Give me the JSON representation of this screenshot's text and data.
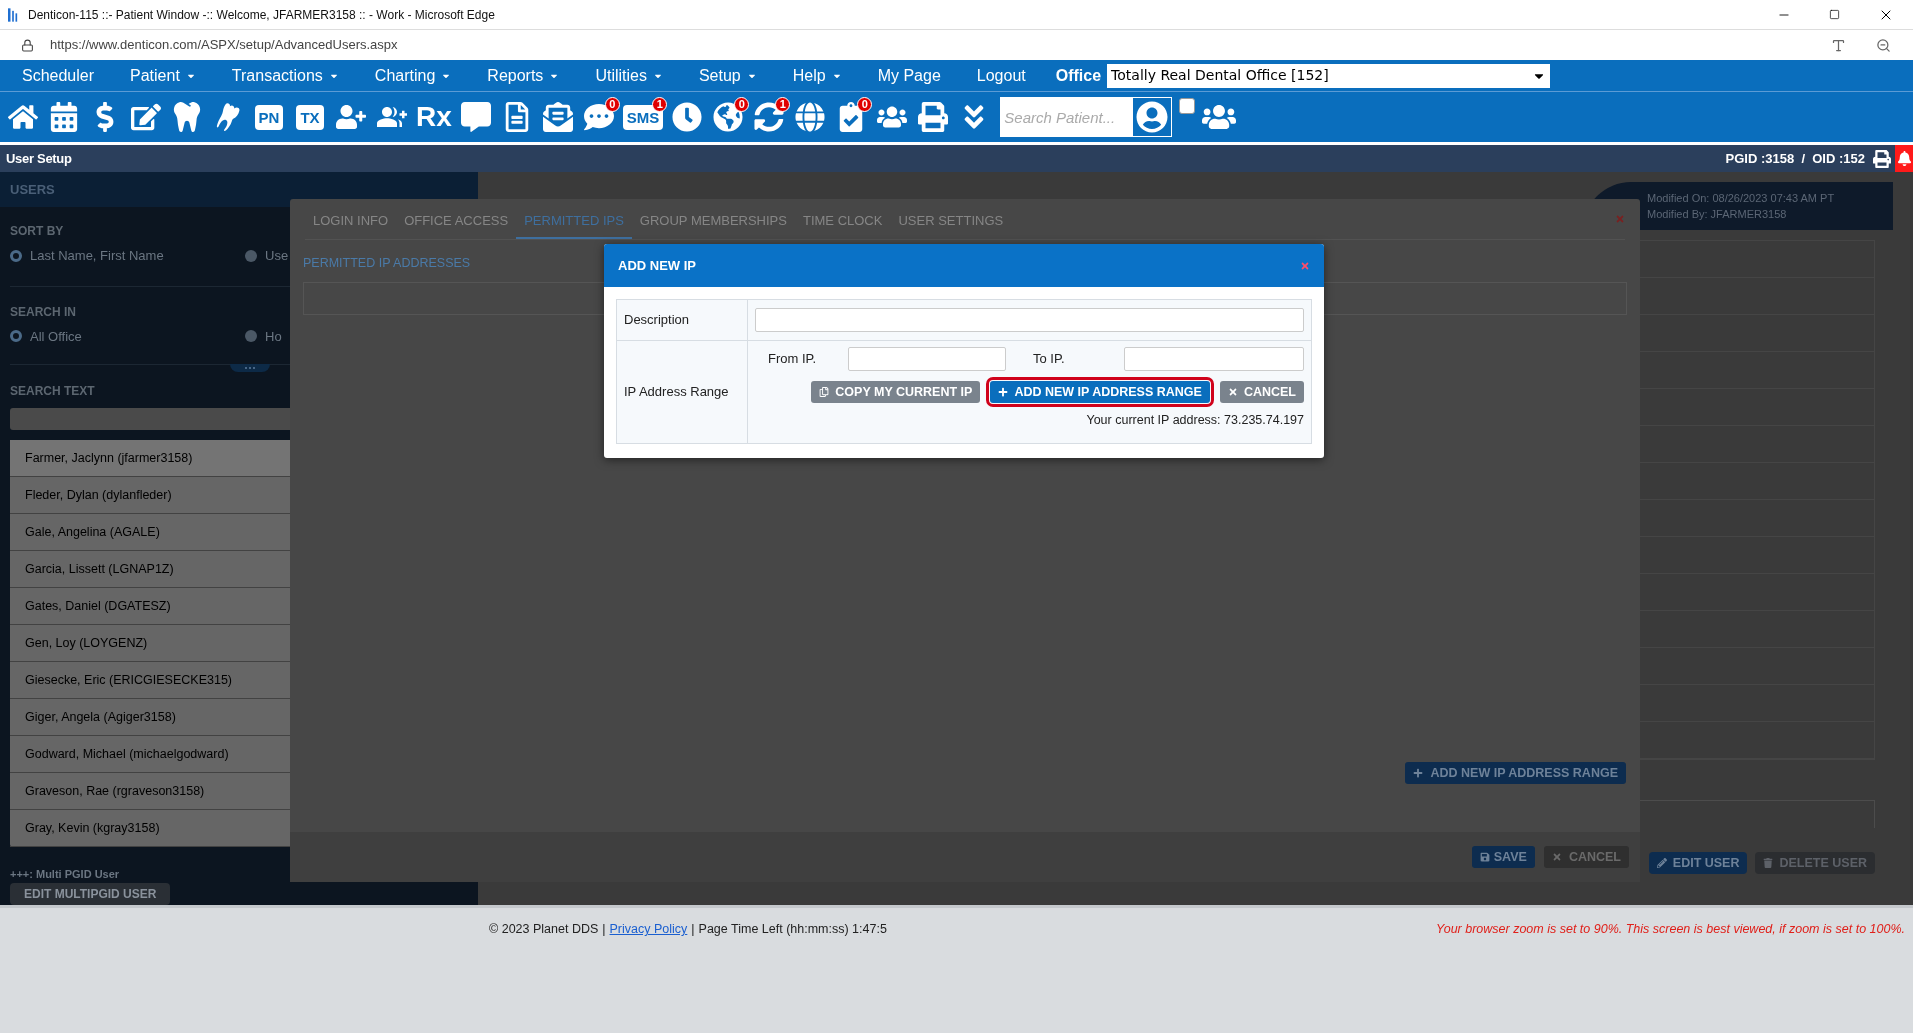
{
  "browser": {
    "title": "Denticon-115 ::- Patient Window -:: Welcome, JFARMER3158 :: - Work - Microsoft Edge",
    "url": "https://www.denticon.com/ASPX/setup/AdvancedUsers.aspx"
  },
  "menu": {
    "items": [
      {
        "label": "Scheduler",
        "dropdown": false
      },
      {
        "label": "Patient",
        "dropdown": true
      },
      {
        "label": "Transactions",
        "dropdown": true
      },
      {
        "label": "Charting",
        "dropdown": true
      },
      {
        "label": "Reports",
        "dropdown": true
      },
      {
        "label": "Utilities",
        "dropdown": true
      },
      {
        "label": "Setup",
        "dropdown": true
      },
      {
        "label": "Help",
        "dropdown": true
      },
      {
        "label": "My Page",
        "dropdown": false
      },
      {
        "label": "Logout",
        "dropdown": false
      }
    ],
    "office_label": "Office",
    "office_value": "Totally Real Dental Office [152]"
  },
  "toolbar": {
    "items": [
      {
        "kind": "icon"
      },
      {
        "kind": "icon"
      },
      {
        "kind": "icon"
      },
      {
        "kind": "icon"
      },
      {
        "kind": "icon"
      },
      {
        "kind": "icon"
      },
      {
        "kind": "label",
        "label": "PN"
      },
      {
        "kind": "label",
        "label": "TX"
      },
      {
        "kind": "icon"
      },
      {
        "kind": "icon"
      },
      {
        "kind": "glyph",
        "label": "Rx"
      },
      {
        "kind": "icon"
      },
      {
        "kind": "icon"
      },
      {
        "kind": "icon"
      },
      {
        "kind": "icon",
        "badge": "0"
      },
      {
        "kind": "label",
        "label": "SMS",
        "badge": "1"
      },
      {
        "kind": "icon"
      },
      {
        "kind": "icon",
        "badge": "0"
      },
      {
        "kind": "icon",
        "badge": "1"
      },
      {
        "kind": "icon"
      },
      {
        "kind": "icon",
        "badge": "0"
      },
      {
        "kind": "icon"
      },
      {
        "kind": "icon"
      },
      {
        "kind": "icon"
      }
    ],
    "search_placeholder": "Search Patient...",
    "checkbox_checked": false
  },
  "page_header": {
    "title": "User Setup",
    "ids": "PGID :3158  /  OID :152"
  },
  "users_panel": {
    "title": "USERS",
    "sort_by": {
      "label": "SORT BY",
      "options": [
        {
          "label": "Last Name, First Name",
          "selected": true
        },
        {
          "label": "Use",
          "selected": false
        }
      ]
    },
    "search_in": {
      "label": "SEARCH IN",
      "options": [
        {
          "label": "All Office",
          "selected": true
        },
        {
          "label": "Ho",
          "selected": false
        }
      ]
    },
    "search_text_label": "SEARCH TEXT",
    "users": [
      {
        "name": "Farmer, Jaclynn (jfarmer3158)",
        "selected": true
      },
      {
        "name": "Fleder, Dylan (dylanfleder)",
        "selected": false
      },
      {
        "name": "Gale, Angelina (AGALE)",
        "selected": false
      },
      {
        "name": "Garcia, Lissett (LGNAP1Z)",
        "selected": false
      },
      {
        "name": "Gates, Daniel (DGATESZ)",
        "selected": false
      },
      {
        "name": "Gen, Loy (LOYGENZ)",
        "selected": false
      },
      {
        "name": "Giesecke, Eric (ERICGIESECKE315)",
        "selected": false
      },
      {
        "name": "Giger, Angela (Agiger3158)",
        "selected": false
      },
      {
        "name": "Godward, Michael (michaelgodward)",
        "selected": false
      },
      {
        "name": "Graveson, Rae (rgraveson3158)",
        "selected": false
      },
      {
        "name": "Gray, Kevin (kgray3158)",
        "selected": false
      }
    ],
    "legend": "+++: Multi PGID User",
    "button": "EDIT MULTIPGID USER"
  },
  "record": {
    "modified_on": "Modified On: 08/26/2023 07:43 AM PT",
    "modified_by": "Modified By: JFARMER3158",
    "edit_button": "EDIT USER",
    "delete_button": "DELETE USER"
  },
  "user_dialog": {
    "tabs": [
      {
        "label": "LOGIN INFO",
        "selected": false
      },
      {
        "label": "OFFICE ACCESS",
        "selected": false
      },
      {
        "label": "PERMITTED IPS",
        "selected": true
      },
      {
        "label": "GROUP MEMBERSHIPS",
        "selected": false
      },
      {
        "label": "TIME CLOCK",
        "selected": false
      },
      {
        "label": "USER SETTINGS",
        "selected": false
      }
    ],
    "section_title": "PERMITTED IP ADDRESSES",
    "add_button": "ADD NEW IP ADDRESS RANGE",
    "save_button": "SAVE",
    "cancel_button": "CANCEL"
  },
  "add_ip_dialog": {
    "title": "ADD NEW IP",
    "description_label": "Description",
    "range_label": "IP Address Range",
    "from_label": "From IP.",
    "to_label": "To IP.",
    "buttons": [
      {
        "kind": "copy",
        "label": "COPY MY CURRENT IP",
        "highlighted": false
      },
      {
        "kind": "add",
        "label": "ADD NEW IP ADDRESS RANGE",
        "highlighted": true
      },
      {
        "kind": "cancel",
        "label": "CANCEL",
        "highlighted": false
      }
    ],
    "current_ip": "Your current IP address: 73.235.74.197"
  },
  "footer": {
    "items": [
      {
        "kind": "text",
        "text": "© 2023 Planet DDS"
      },
      {
        "kind": "separator",
        "text": "|"
      },
      {
        "kind": "link",
        "text": "Privacy Policy"
      },
      {
        "kind": "separator",
        "text": "|"
      },
      {
        "kind": "text",
        "text": "Page Time Left (hh:mm:ss) 1:47:5"
      }
    ],
    "zoom_warning": "Your browser zoom is set to 90%. This screen is best viewed, if zoom is set to 100%."
  }
}
